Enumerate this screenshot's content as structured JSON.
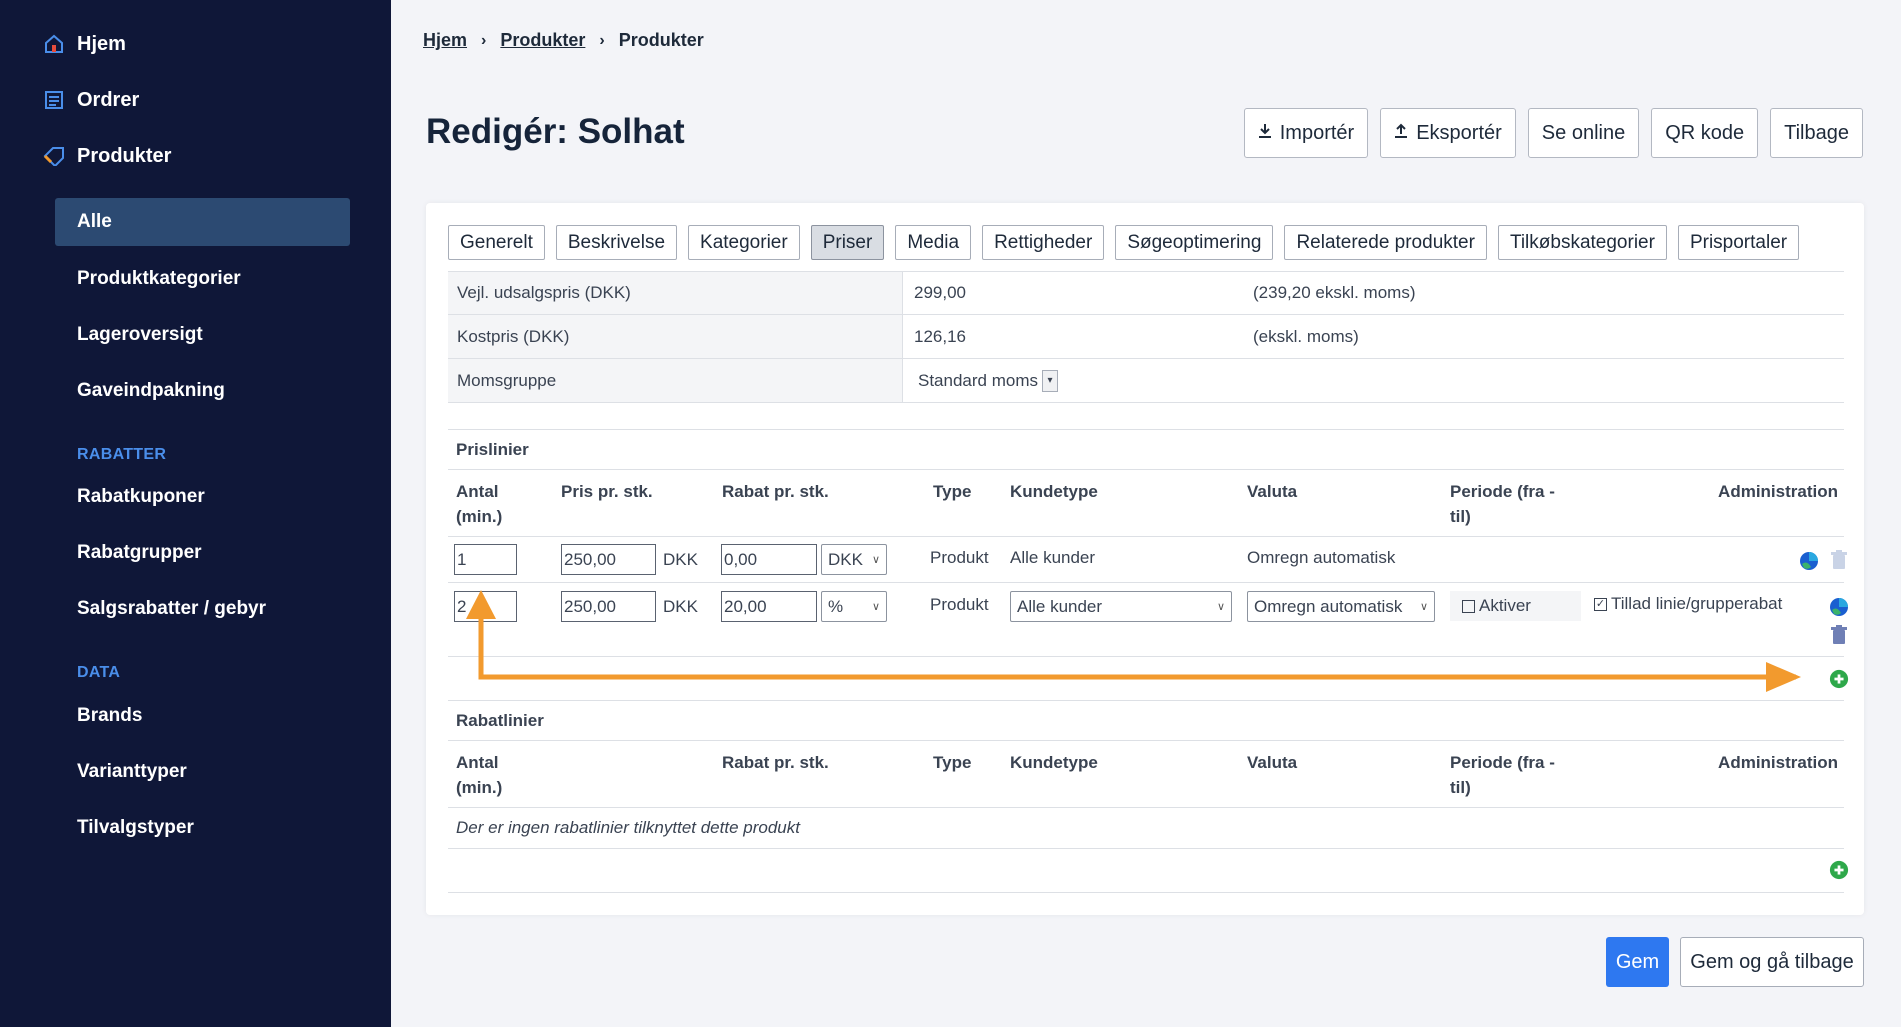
{
  "sidebar": {
    "main_items": [
      {
        "label": "Hjem",
        "icon": "home-icon"
      },
      {
        "label": "Ordrer",
        "icon": "list-icon"
      },
      {
        "label": "Produkter",
        "icon": "tag-icon"
      }
    ],
    "product_items": [
      "Alle",
      "Produktkategorier",
      "Lageroversigt",
      "Gaveindpakning"
    ],
    "sections": {
      "rabatter": {
        "title": "RABATTER",
        "items": [
          "Rabatkuponer",
          "Rabatgrupper",
          "Salgsrabatter / gebyr"
        ]
      },
      "data": {
        "title": "DATA",
        "items": [
          "Brands",
          "Varianttyper",
          "Tilvalgstyper"
        ]
      }
    },
    "active_item": "Alle",
    "accent_color": "#4a8eea"
  },
  "breadcrumb": [
    "Hjem",
    "Produkter",
    "Produkter"
  ],
  "page_title": "Redigér: Solhat",
  "top_buttons": [
    {
      "label": "Importér",
      "icon": "download-icon"
    },
    {
      "label": "Eksportér",
      "icon": "upload-icon"
    },
    {
      "label": "Se online"
    },
    {
      "label": "QR kode"
    },
    {
      "label": "Tilbage"
    }
  ],
  "tabs": [
    "Generelt",
    "Beskrivelse",
    "Kategorier",
    "Priser",
    "Media",
    "Rettigheder",
    "Søgeoptimering",
    "Relaterede produkter",
    "Tilkøbskategorier",
    "Prisportaler"
  ],
  "active_tab": "Priser",
  "properties": [
    {
      "label": "Vejl. udsalgspris (DKK)",
      "value": "299,00",
      "note": "(239,20 ekskl. moms)"
    },
    {
      "label": "Kostpris (DKK)",
      "value": "126,16",
      "note": "(ekskl. moms)"
    },
    {
      "label": "Momsgruppe",
      "value": "Standard moms",
      "note": ""
    }
  ],
  "prislinier": {
    "title": "Prislinier",
    "headers": {
      "antal": "Antal (min.)",
      "pris": "Pris pr. stk.",
      "rabat": "Rabat pr. stk.",
      "type": "Type",
      "kundetype": "Kundetype",
      "valuta": "Valuta",
      "periode": "Periode (fra - til)",
      "admin": "Administration"
    },
    "rows": [
      {
        "antal": "1",
        "pris": "250,00",
        "pris_unit": "DKK",
        "rabat": "0,00",
        "rabat_unit": "DKK",
        "type": "Produkt",
        "kundetype": "Alle kunder",
        "valuta": "Omregn automatisk"
      },
      {
        "antal": "2",
        "pris": "250,00",
        "pris_unit": "DKK",
        "rabat": "20,00",
        "rabat_unit": "%",
        "type": "Produkt",
        "kundetype": "Alle kunder",
        "valuta": "Omregn automatisk",
        "aktiver": "Aktiver",
        "tillad": "Tillad linie/grupperabat"
      }
    ]
  },
  "rabatlinier": {
    "title": "Rabatlinier",
    "headers": {
      "antal": "Antal (min.)",
      "rabat": "Rabat pr. stk.",
      "type": "Type",
      "kundetype": "Kundetype",
      "valuta": "Valuta",
      "periode": "Periode (fra - til)",
      "admin": "Administration"
    },
    "empty_text": "Der er ingen rabatlinier tilknyttet dette produkt"
  },
  "footer_buttons": {
    "save": "Gem",
    "save_back": "Gem og gå tilbage"
  },
  "annotation_color": "#f29a2e",
  "primary_color": "#2e78f0"
}
